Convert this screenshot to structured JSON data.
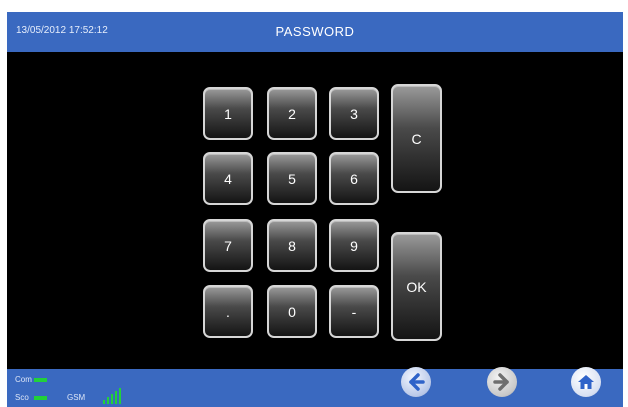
{
  "header": {
    "datetime": "13/05/2012 17:52:12",
    "title": "PASSWORD"
  },
  "keypad": {
    "digits": [
      "1",
      "2",
      "3",
      "4",
      "5",
      "6",
      "7",
      "8",
      "9",
      ".",
      "0",
      "-"
    ],
    "clear_label": "C",
    "ok_label": "OK"
  },
  "status": {
    "com_label": "Com",
    "sco_label": "Sco",
    "gsm_label": "GSM",
    "indicator_color": "#22d13a"
  },
  "colors": {
    "bar": "#3a69c0",
    "screen": "#000000",
    "back_arrow": "#2f63c9",
    "fwd_arrow": "#6f6f6f",
    "home": "#2f63c9"
  },
  "navigation": {
    "back_icon": "left-arrow-icon",
    "forward_icon": "right-arrow-icon",
    "home_icon": "home-icon"
  }
}
